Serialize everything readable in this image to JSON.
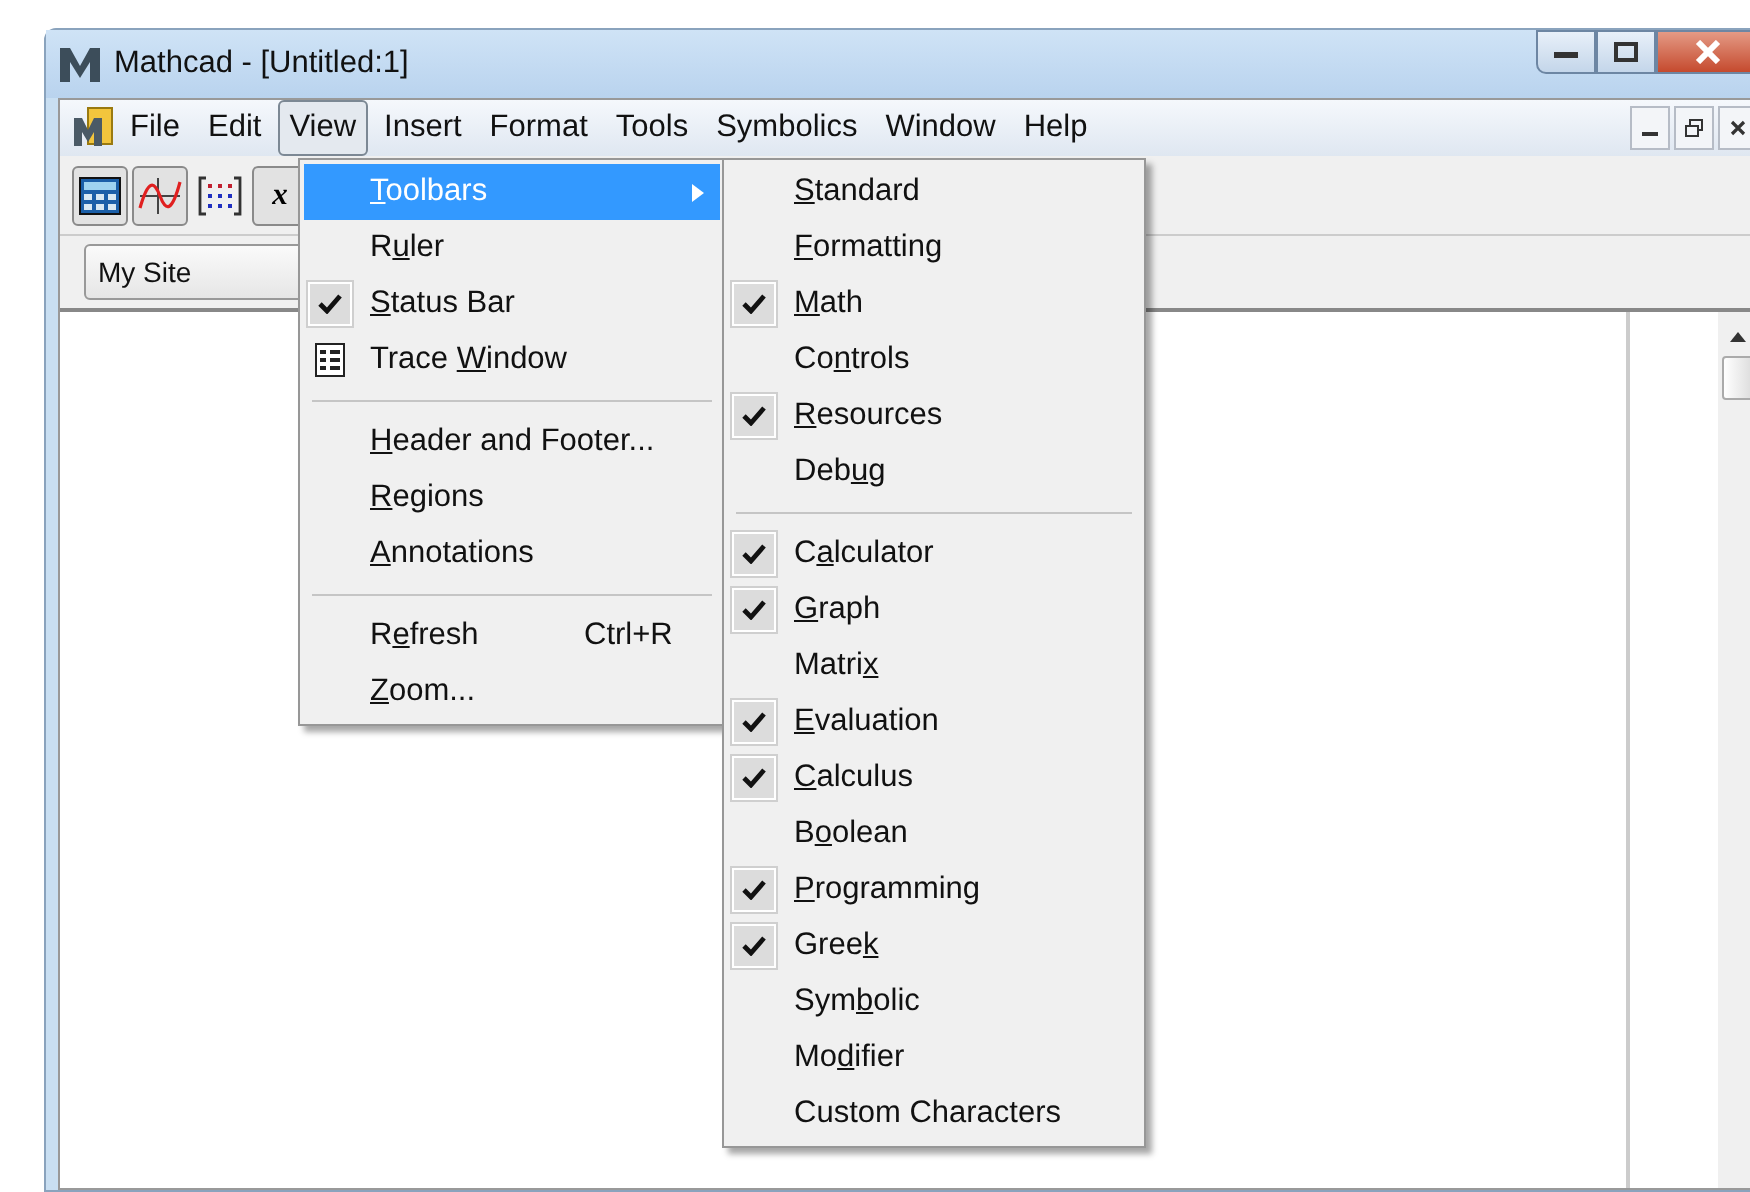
{
  "window": {
    "title": "Mathcad - [Untitled:1]"
  },
  "menu_bar": [
    {
      "label": "File",
      "selected": false
    },
    {
      "label": "Edit",
      "selected": false
    },
    {
      "label": "View",
      "selected": true
    },
    {
      "label": "Insert",
      "selected": false
    },
    {
      "label": "Format",
      "selected": false
    },
    {
      "label": "Tools",
      "selected": false
    },
    {
      "label": "Symbolics",
      "selected": false
    },
    {
      "label": "Window",
      "selected": false
    },
    {
      "label": "Help",
      "selected": false
    }
  ],
  "toolbar": [
    {
      "kind": "calculator",
      "pressed": true
    },
    {
      "kind": "graph",
      "pressed": true
    },
    {
      "kind": "matrix",
      "pressed": false
    },
    {
      "kind": "text",
      "label": "x",
      "pressed": true
    }
  ],
  "site_dropdown": {
    "value": "My Site"
  },
  "view_menu": [
    {
      "kind": "item",
      "label": {
        "key": "T",
        "post": "oolbars"
      },
      "submenu": true,
      "selected": true,
      "checked": false
    },
    {
      "kind": "item",
      "label": {
        "pre": "R",
        "key": "u",
        "post": "ler"
      },
      "selected": false,
      "checked": false
    },
    {
      "kind": "item",
      "label": {
        "key": "S",
        "post": "tatus Bar"
      },
      "selected": false,
      "checked": true
    },
    {
      "kind": "icon_item",
      "label": {
        "pre": "Trace ",
        "key": "W",
        "post": "indow"
      },
      "selected": false,
      "checked": false
    },
    {
      "kind": "separator"
    },
    {
      "kind": "item",
      "label": {
        "key": "H",
        "post": "eader and Footer..."
      },
      "selected": false,
      "checked": false
    },
    {
      "kind": "item",
      "label": {
        "key": "R",
        "post": "egions"
      },
      "selected": false,
      "checked": false
    },
    {
      "kind": "item",
      "label": {
        "key": "A",
        "post": "nnotations"
      },
      "selected": false,
      "checked": false
    },
    {
      "kind": "separator"
    },
    {
      "kind": "item",
      "label": {
        "pre": "R",
        "key": "e",
        "post": "fresh"
      },
      "shortcut": "Ctrl+R",
      "selected": false,
      "checked": false
    },
    {
      "kind": "item",
      "label": {
        "key": "Z",
        "post": "oom..."
      },
      "selected": false,
      "checked": false
    }
  ],
  "toolbars_submenu": [
    {
      "kind": "item",
      "label": {
        "key": "S",
        "post": "tandard"
      },
      "checked": false
    },
    {
      "kind": "item",
      "label": {
        "key": "F",
        "post": "ormatting"
      },
      "checked": false
    },
    {
      "kind": "item",
      "label": {
        "key": "M",
        "post": "ath"
      },
      "checked": true
    },
    {
      "kind": "item",
      "label": {
        "pre": "Co",
        "key": "n",
        "post": "trols"
      },
      "checked": false
    },
    {
      "kind": "item",
      "label": {
        "key": "R",
        "post": "esources"
      },
      "checked": true
    },
    {
      "kind": "item",
      "label": {
        "pre": "Deb",
        "key": "u",
        "post": "g"
      },
      "checked": false
    },
    {
      "kind": "separator"
    },
    {
      "kind": "item",
      "label": {
        "pre": "C",
        "key": "a",
        "post": "lculator"
      },
      "checked": true
    },
    {
      "kind": "item",
      "label": {
        "key": "G",
        "post": "raph"
      },
      "checked": true
    },
    {
      "kind": "item",
      "label": {
        "pre": "Matri",
        "key": "x"
      },
      "checked": false
    },
    {
      "kind": "item",
      "label": {
        "key": "E",
        "post": "valuation"
      },
      "checked": true
    },
    {
      "kind": "item",
      "label": {
        "key": "C",
        "post": "alculus"
      },
      "checked": true
    },
    {
      "kind": "item",
      "label": {
        "pre": "B",
        "key": "o",
        "post": "olean"
      },
      "checked": false
    },
    {
      "kind": "item",
      "label": {
        "key": "P",
        "post": "rogramming"
      },
      "checked": true
    },
    {
      "kind": "item",
      "label": {
        "pre": "Gree",
        "key": "k"
      },
      "checked": true
    },
    {
      "kind": "item",
      "label": {
        "pre": "Sym",
        "key": "b",
        "post": "olic"
      },
      "checked": false
    },
    {
      "kind": "item",
      "label": {
        "pre": "Mo",
        "key": "d",
        "post": "ifier"
      },
      "checked": false
    },
    {
      "kind": "item",
      "label": {
        "pre": "Custom Characters"
      },
      "checked": false
    }
  ]
}
